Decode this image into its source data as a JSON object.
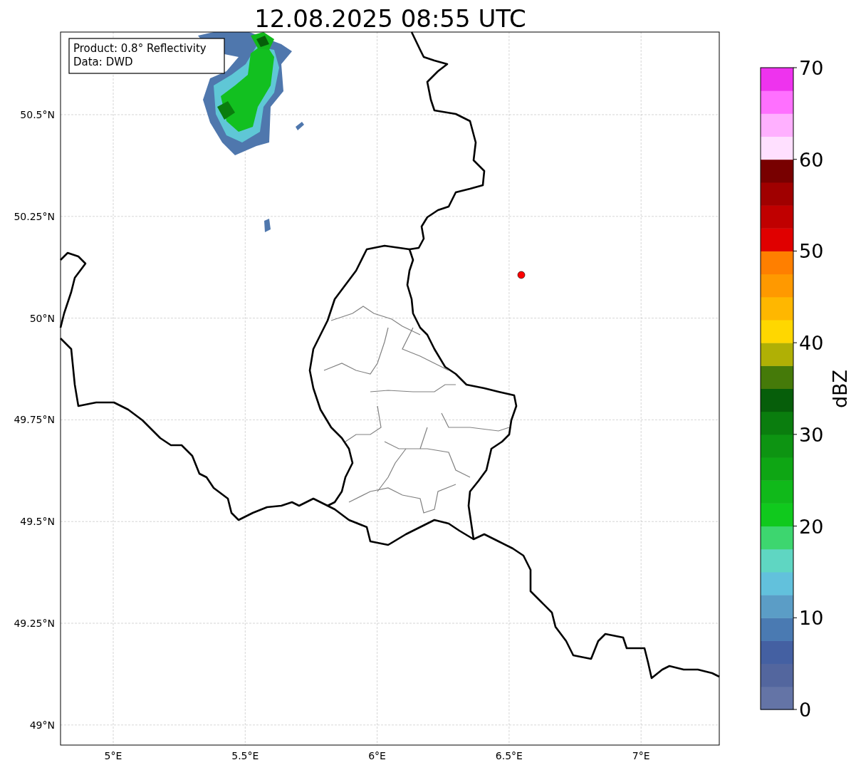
{
  "title": "12.08.2025 08:55 UTC",
  "info_box": {
    "lines": [
      "Product: 0.8° Reflectivity",
      "Data: DWD"
    ]
  },
  "map": {
    "y_ticks": [
      "50.5°N",
      "50.25°N",
      "50°N",
      "49.75°N",
      "49.5°N",
      "49.25°N",
      "49°N"
    ],
    "x_ticks": [
      "5°E",
      "5.5°E",
      "6°E",
      "6.5°E",
      "7°E"
    ]
  },
  "colorbar": {
    "label": "dBZ",
    "ticks": [
      "70",
      "60",
      "50",
      "40",
      "30",
      "20",
      "10",
      "0"
    ],
    "bins": [
      {
        "color": "#6474a6"
      },
      {
        "color": "#53669e"
      },
      {
        "color": "#4460a2"
      },
      {
        "color": "#4a7ab2"
      },
      {
        "color": "#5b9dc6"
      },
      {
        "color": "#62c1dc"
      },
      {
        "color": "#5fd6c2"
      },
      {
        "color": "#3dd66f"
      },
      {
        "color": "#10c91d"
      },
      {
        "color": "#10b91a"
      },
      {
        "color": "#0ea614"
      },
      {
        "color": "#0d9412"
      },
      {
        "color": "#0a7d0e"
      },
      {
        "color": "#065e0a"
      },
      {
        "color": "#457a09"
      },
      {
        "color": "#b0b005"
      },
      {
        "color": "#ffd700"
      },
      {
        "color": "#ffb700"
      },
      {
        "color": "#ff9900"
      },
      {
        "color": "#ff7f00"
      },
      {
        "color": "#e00000"
      },
      {
        "color": "#c00000"
      },
      {
        "color": "#a00000"
      },
      {
        "color": "#780000"
      },
      {
        "color": "#ffe0ff"
      },
      {
        "color": "#ffb0ff"
      },
      {
        "color": "#ff70ff"
      },
      {
        "color": "#ee33ee"
      }
    ]
  }
}
